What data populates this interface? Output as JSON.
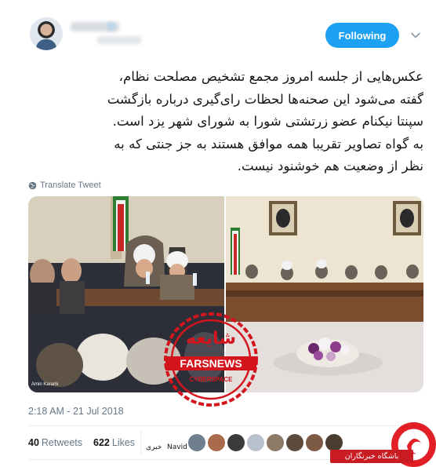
{
  "tweet": {
    "follow_label": "Following",
    "text_lines": [
      "عکس‌هایی از جلسه امروز مجمع تشخیص مصلحت نظام،",
      "گفته می‌شود این صحنه‌ها لحظات رای‌گیری درباره بازگشت",
      "سپنتا نیکنام عضو زرتشتی شورا به شورای شهر یزد است.",
      "به گواه تصاویر تقریبا همه موافق هستند به جز جنتی که به",
      "نظر از وضعیت هم خوشنود نیست."
    ],
    "translate_label": "Translate Tweet",
    "photo_caption": "Amin Karami",
    "timestamp": "2:18 AM - 21 Jul 2018",
    "retweets_count": "40",
    "retweets_label": "Retweets",
    "likes_count": "622",
    "likes_label": "Likes",
    "liker_labels": [
      "خبری",
      "Navid"
    ]
  },
  "stamp": {
    "title": "شایعه",
    "brand": "FARSNEWS",
    "sub": "CYBERSPACE",
    "color": "#d3151d"
  },
  "watermark": {
    "label": "باشگاه خبرنگاران"
  },
  "colors": {
    "accent": "#1da1f2",
    "text": "#14171a",
    "muted": "#657786"
  }
}
